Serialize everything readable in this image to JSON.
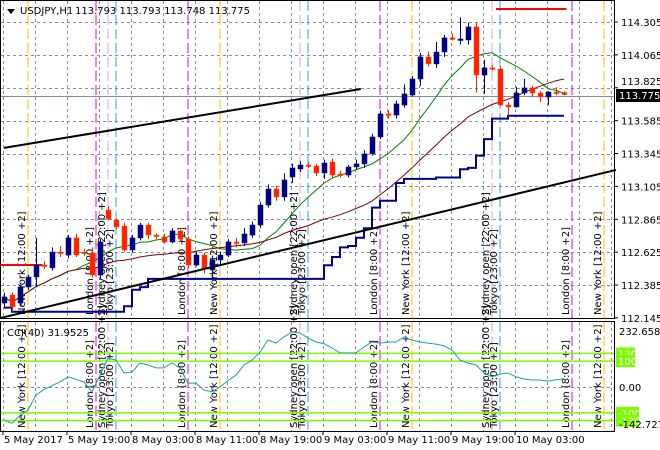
{
  "header": {
    "symbol": "USDJPY,H1",
    "quote": "113.793 113.793 113.748 113.775",
    "current_price": "113.775"
  },
  "indicator": {
    "title": "CCI(40) 31.9525",
    "axis_top": "232.6588",
    "axis_zero": "0.00",
    "axis_bottom": "-142.7279",
    "levels": [
      "130",
      "100",
      "-100",
      "-130"
    ]
  },
  "colors": {
    "bull": "#000080",
    "bear": "#ff2000",
    "ma_fast": "#008000",
    "ma_slow": "#800000",
    "trail": "#000090",
    "cci": "#20a0a0",
    "level": "#7cfc00",
    "new_york": "#f0c000",
    "london": "#e000e0",
    "sydney": "#d8a0d8",
    "tokyo": "#20a8e0"
  },
  "chart_data": {
    "type": "candlestick",
    "title": "USDJPY,H1",
    "price_ticks": [
      "114.305",
      "114.065",
      "113.825",
      "113.585",
      "113.345",
      "113.105",
      "112.865",
      "112.625",
      "112.385",
      "112.145"
    ],
    "ylim": [
      112.145,
      114.305
    ],
    "time_labels": [
      {
        "bar": 0,
        "label": "5 May 2017"
      },
      {
        "bar": 8,
        "label": "5 May 19:00"
      },
      {
        "bar": 16,
        "label": "8 May 03:00"
      },
      {
        "bar": 24,
        "label": "8 May 11:00"
      },
      {
        "bar": 32,
        "label": "8 May 19:00"
      },
      {
        "bar": 40,
        "label": "9 May 03:00"
      },
      {
        "bar": 48,
        "label": "9 May 11:00"
      },
      {
        "bar": 56,
        "label": "9 May 19:00"
      },
      {
        "bar": 64,
        "label": "10 May 03:00"
      }
    ],
    "ohlc": [
      [
        112.254,
        112.33,
        112.22,
        112.298
      ],
      [
        112.312,
        112.33,
        112.19,
        112.225
      ],
      [
        112.254,
        112.39,
        112.23,
        112.371
      ],
      [
        112.371,
        112.46,
        112.35,
        112.444
      ],
      [
        112.444,
        112.729,
        112.37,
        112.531
      ],
      [
        112.531,
        112.56,
        112.5,
        112.524
      ],
      [
        112.51,
        112.66,
        112.49,
        112.626
      ],
      [
        112.626,
        112.67,
        112.59,
        112.619
      ],
      [
        112.604,
        112.75,
        112.58,
        112.729
      ],
      [
        112.729,
        112.76,
        112.59,
        112.604
      ],
      [
        112.625,
        112.65,
        112.6,
        112.619
      ],
      [
        112.619,
        112.66,
        112.44,
        112.458
      ],
      [
        112.458,
        112.72,
        112.43,
        112.699
      ],
      [
        112.933,
        112.96,
        112.86,
        112.867
      ],
      [
        112.86,
        112.87,
        112.79,
        112.809
      ],
      [
        112.816,
        112.84,
        112.63,
        112.641
      ],
      [
        112.641,
        112.75,
        112.62,
        112.729
      ],
      [
        112.729,
        112.84,
        112.71,
        112.823
      ],
      [
        112.823,
        112.84,
        112.72,
        112.75
      ],
      [
        112.75,
        112.76,
        112.72,
        112.743
      ],
      [
        112.736,
        112.76,
        112.69,
        112.699
      ],
      [
        112.699,
        112.8,
        112.69,
        112.78
      ],
      [
        112.78,
        112.79,
        112.7,
        112.721
      ],
      [
        112.721,
        112.74,
        112.51,
        112.531
      ],
      [
        112.531,
        112.63,
        112.52,
        112.604
      ],
      [
        112.604,
        112.62,
        112.47,
        112.502
      ],
      [
        112.495,
        112.6,
        112.43,
        112.568
      ],
      [
        112.568,
        112.63,
        112.53,
        112.604
      ],
      [
        112.604,
        112.72,
        112.59,
        112.699
      ],
      [
        112.699,
        112.73,
        112.66,
        112.692
      ],
      [
        112.692,
        112.8,
        112.67,
        112.758
      ],
      [
        112.75,
        112.85,
        112.73,
        112.823
      ],
      [
        112.823,
        112.99,
        112.8,
        112.969
      ],
      [
        112.969,
        113.12,
        112.95,
        113.086
      ],
      [
        113.086,
        113.11,
        113.0,
        113.028
      ],
      [
        113.028,
        113.2,
        113.0,
        113.152
      ],
      [
        113.174,
        113.27,
        113.13,
        113.24
      ],
      [
        113.232,
        113.29,
        113.21,
        113.261
      ],
      [
        113.261,
        113.28,
        113.24,
        113.254
      ],
      [
        113.254,
        113.27,
        113.18,
        113.203
      ],
      [
        113.203,
        113.3,
        113.16,
        113.276
      ],
      [
        113.283,
        113.31,
        113.17,
        113.188
      ],
      [
        113.195,
        113.22,
        113.17,
        113.188
      ],
      [
        113.188,
        113.26,
        113.17,
        113.247
      ],
      [
        113.247,
        113.3,
        113.23,
        113.269
      ],
      [
        113.269,
        113.37,
        113.24,
        113.342
      ],
      [
        113.342,
        113.49,
        113.33,
        113.466
      ],
      [
        113.466,
        113.66,
        113.45,
        113.634
      ],
      [
        113.634,
        113.66,
        113.6,
        113.626
      ],
      [
        113.626,
        113.73,
        113.6,
        113.707
      ],
      [
        113.699,
        113.85,
        113.68,
        113.78
      ],
      [
        113.772,
        113.91,
        113.76,
        113.889
      ],
      [
        113.889,
        114.08,
        113.84,
        114.05
      ],
      [
        114.05,
        114.09,
        113.98,
        113.999
      ],
      [
        113.999,
        114.16,
        113.97,
        114.086
      ],
      [
        114.086,
        114.21,
        114.05,
        114.189
      ],
      [
        114.189,
        114.22,
        114.17,
        114.181
      ],
      [
        114.174,
        114.34,
        114.14,
        114.181
      ],
      [
        114.174,
        114.3,
        114.14,
        114.269
      ],
      [
        114.269,
        114.3,
        113.79,
        113.918
      ],
      [
        113.918,
        114.03,
        113.78,
        113.97
      ],
      [
        113.97,
        113.99,
        113.95,
        113.962
      ],
      [
        113.962,
        113.98,
        113.69,
        113.699
      ],
      [
        113.699,
        113.72,
        113.62,
        113.685
      ],
      [
        113.685,
        113.83,
        113.68,
        113.787
      ],
      [
        113.787,
        113.89,
        113.77,
        113.824
      ],
      [
        113.824,
        113.84,
        113.76,
        113.787
      ],
      [
        113.787,
        113.8,
        113.72,
        113.758
      ],
      [
        113.758,
        113.8,
        113.7,
        113.794
      ],
      [
        113.794,
        113.83,
        113.77,
        113.79
      ],
      [
        113.79,
        113.8,
        113.77,
        113.775
      ]
    ],
    "cci": [
      -128,
      -140,
      -110,
      -89,
      -31,
      -10,
      5,
      20,
      39,
      30,
      19,
      -19,
      46,
      112,
      104,
      54,
      58,
      93,
      85,
      74,
      74,
      93,
      74,
      15,
      15,
      -12,
      -19,
      0,
      25,
      46,
      85,
      104,
      135,
      182,
      170,
      194,
      213,
      209,
      190,
      174,
      168,
      151,
      132,
      132,
      132,
      155,
      174,
      170,
      174,
      174,
      194,
      182,
      174,
      170,
      166,
      159,
      143,
      104,
      93,
      85,
      54,
      39,
      50,
      54,
      39,
      31,
      27,
      27,
      23,
      28,
      32
    ],
    "cci_range": [
      -142.7279,
      232.6588
    ],
    "cci_levels": [
      130,
      100,
      -100,
      -130
    ],
    "ma_fast_period": 10,
    "ma_slow_period": 24,
    "trail_period": 14,
    "trendlines": [
      {
        "bar1": 0,
        "price1": 113.386,
        "bar2": 44.6,
        "price2": 113.816
      },
      {
        "bar1": -0.4,
        "price1": 112.145,
        "bar2": 76.5,
        "price2": 113.225
      }
    ],
    "levels": [
      {
        "bar1": -0.4,
        "bar2": 4.8,
        "price": 112.531
      },
      {
        "bar1": 61.5,
        "bar2": 70.3,
        "price": 114.4
      }
    ],
    "sessions": [
      {
        "bar": 3,
        "session": "new_york",
        "label": "New York  [12:00 +2]"
      },
      {
        "bar": 11.5,
        "session": "london",
        "label": "London  [8:00 +2]"
      },
      {
        "bar": 13,
        "session": "sydney",
        "label": "Sydney open  [22:00 +2]"
      },
      {
        "bar": 14,
        "session": "tokyo",
        "label": "Tokyo  [23:00 +2]"
      },
      {
        "bar": 23,
        "session": "london",
        "label": "London  [8:00 +2]"
      },
      {
        "bar": 27,
        "session": "new_york",
        "label": "New York  [12:00 +2]"
      },
      {
        "bar": 37,
        "session": "sydney",
        "label": "Sydney open  [22:00 +2]"
      },
      {
        "bar": 38,
        "session": "tokyo",
        "label": "Tokyo  [23:00 +2]"
      },
      {
        "bar": 47,
        "session": "london",
        "label": "London  [8:00 +2]"
      },
      {
        "bar": 51,
        "session": "new_york",
        "label": "New York  [12:00 +2]"
      },
      {
        "bar": 61,
        "session": "sydney",
        "label": "Sydney open  [22:00 +2]"
      },
      {
        "bar": 62,
        "session": "tokyo",
        "label": "Tokyo  [23:00 +2]"
      },
      {
        "bar": 71,
        "session": "london",
        "label": "London  [8:00 +2]"
      },
      {
        "bar": 75,
        "session": "new_york",
        "label": "New York  [12:00 +2]"
      }
    ]
  }
}
